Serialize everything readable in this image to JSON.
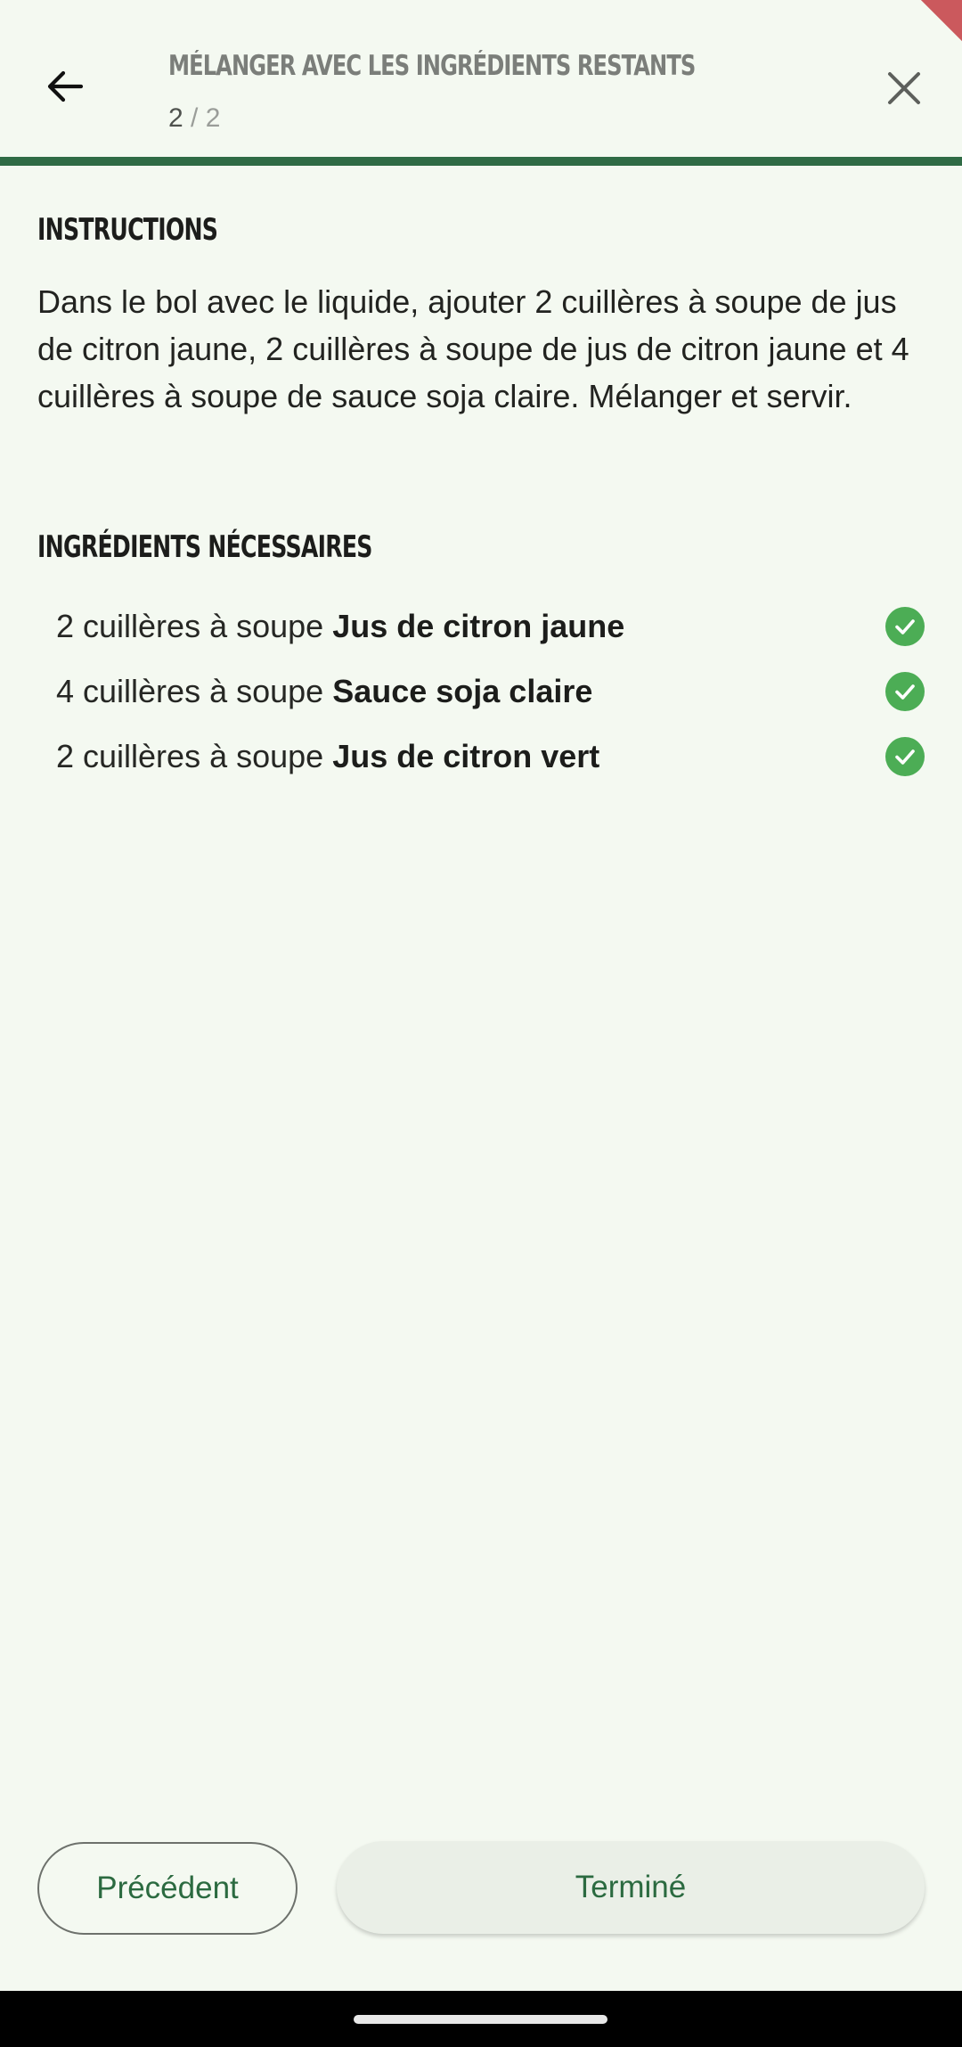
{
  "header": {
    "title": "MÉLANGER AVEC LES INGRÉDIENTS RESTANTS",
    "step_current": "2",
    "step_total": " / 2",
    "progress": 1.0,
    "back_icon": "arrow-left-icon",
    "close_icon": "close-icon"
  },
  "instructions": {
    "heading": "INSTRUCTIONS",
    "text": "Dans le bol avec le liquide, ajouter 2 cuillères à soupe de jus de citron jaune, 2 cuillères à soupe de jus de citron jaune et 4 cuillères à soupe de sauce soja claire. Mélanger et servir."
  },
  "ingredients": {
    "heading": "INGRÉDIENTS NÉCESSAIRES",
    "items": [
      {
        "qty": "2 cuillères à soupe ",
        "name": "Jus de citron jaune",
        "checked": true
      },
      {
        "qty": "4 cuillères à soupe ",
        "name": "Sauce soja claire",
        "checked": true
      },
      {
        "qty": "2 cuillères à soupe ",
        "name": "Jus de citron vert",
        "checked": true
      }
    ]
  },
  "footer": {
    "prev_label": "Précédent",
    "done_label": "Terminé"
  },
  "colors": {
    "accent": "#2f6b45",
    "check": "#4cad55",
    "background": "#f4f9f1"
  }
}
